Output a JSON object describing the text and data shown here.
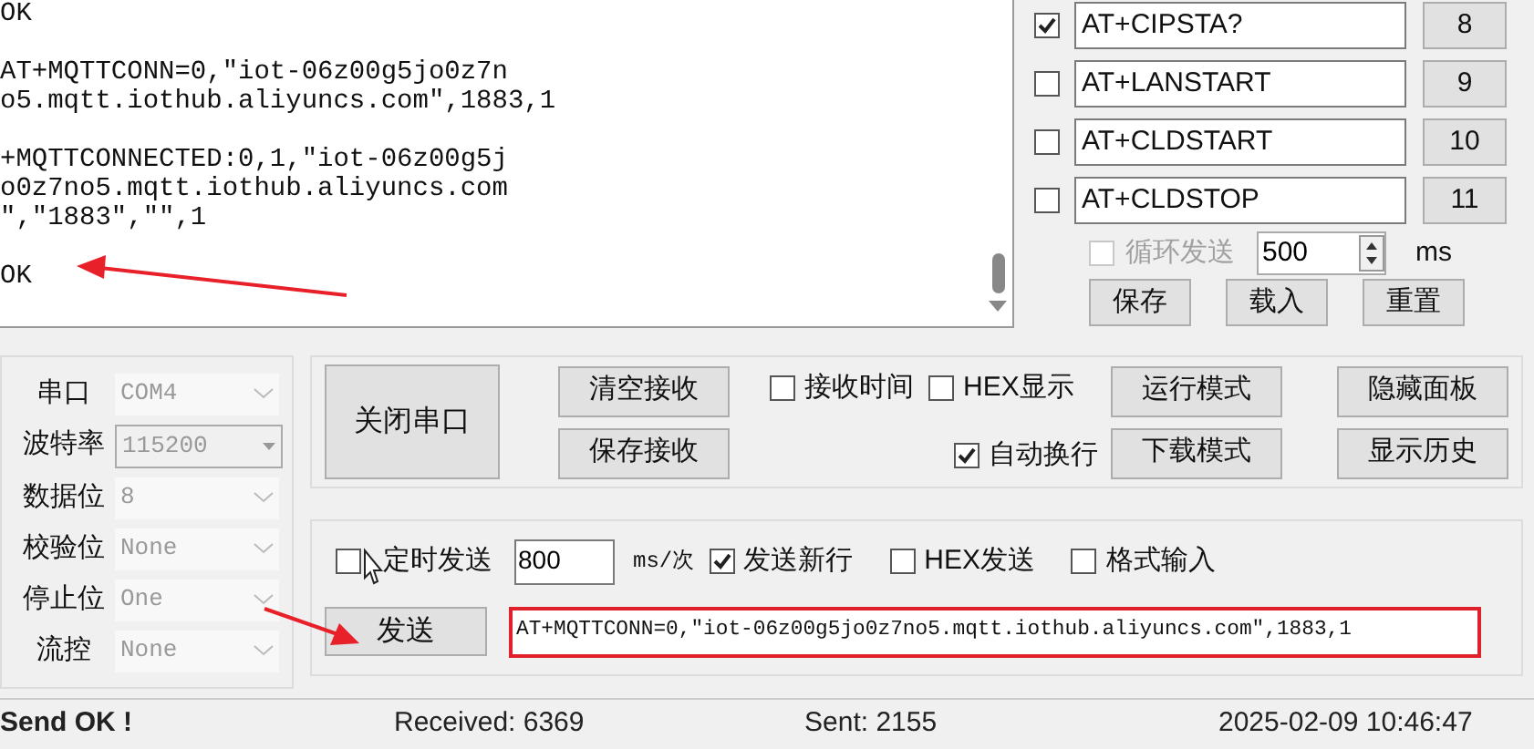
{
  "receive_log": {
    "blocks": [
      [
        "OK"
      ],
      [
        "AT+MQTTCONN=0,\"iot-06z00g5jo0z7n",
        "o5.mqtt.iothub.aliyuncs.com\",1883,1"
      ],
      [
        "+MQTTCONNECTED:0,1,\"iot-06z00g5j",
        "o0z7no5.mqtt.iothub.aliyuncs.com",
        "\",\"1883\",\"\",1"
      ],
      [
        "OK"
      ]
    ]
  },
  "command_list": [
    {
      "checked": true,
      "text": "AT+CIPSTA?",
      "number": "8"
    },
    {
      "checked": false,
      "text": "AT+LANSTART",
      "number": "9"
    },
    {
      "checked": false,
      "text": "AT+CLDSTART",
      "number": "10"
    },
    {
      "checked": false,
      "text": "AT+CLDSTOP",
      "number": "11"
    }
  ],
  "loop_send": {
    "label": "循环发送",
    "checked": false,
    "disabled": true,
    "interval": "500",
    "unit": "ms"
  },
  "preset_buttons": [
    "保存",
    "载入",
    "重置"
  ],
  "serial_settings": [
    {
      "label": "串口",
      "value": "COM4",
      "kind": "dropdown"
    },
    {
      "label": "波特率",
      "value": "115200",
      "kind": "combo"
    },
    {
      "label": "数据位",
      "value": "8",
      "kind": "dropdown"
    },
    {
      "label": "校验位",
      "value": "None",
      "kind": "dropdown"
    },
    {
      "label": "停止位",
      "value": "One",
      "kind": "dropdown"
    },
    {
      "label": "流控",
      "value": "None",
      "kind": "dropdown"
    }
  ],
  "port_button": "关闭串口",
  "receive_buttons": [
    "清空接收",
    "保存接收"
  ],
  "receive_options": [
    {
      "label": "接收时间",
      "checked": false
    },
    {
      "label": "HEX显示",
      "checked": false
    },
    {
      "label": "自动换行",
      "checked": true
    }
  ],
  "mode_buttons": [
    "运行模式",
    "下载模式"
  ],
  "panel_buttons": [
    "隐藏面板",
    "显示历史"
  ],
  "send_options": {
    "timed": {
      "label": "定时发送",
      "checked": false
    },
    "interval": "800",
    "unit": "ms/次",
    "checks": [
      {
        "label": "发送新行",
        "checked": true
      },
      {
        "label": "HEX发送",
        "checked": false
      },
      {
        "label": "格式输入",
        "checked": false
      }
    ]
  },
  "send_button": "发送",
  "send_text": "AT+MQTTCONN=0,\"iot-06z00g5jo0z7no5.mqtt.iothub.aliyuncs.com\",1883,1",
  "status_bar": {
    "message": "Send OK !",
    "received": "Received: 6369",
    "sent": "Sent: 2155",
    "time": "2025-02-09 10:46:47"
  }
}
